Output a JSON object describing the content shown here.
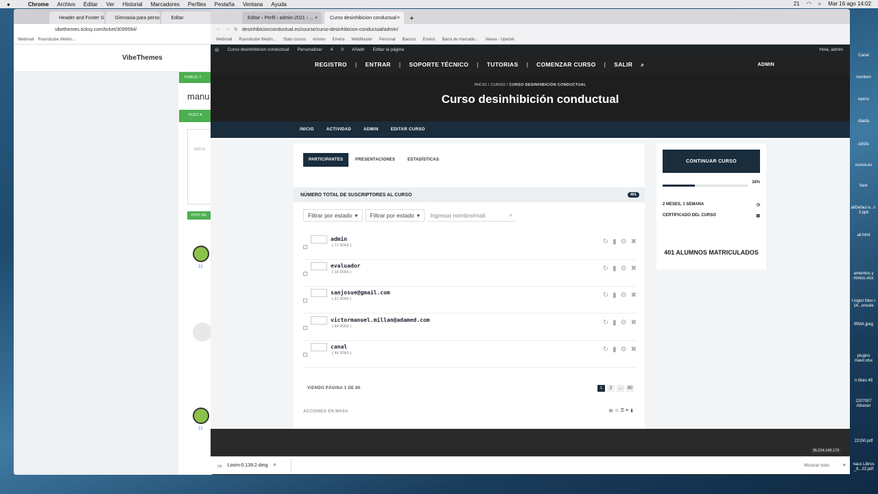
{
  "mac": {
    "menu": [
      "Chrome",
      "Archivo",
      "Editar",
      "Ver",
      "Historial",
      "Marcadores",
      "Perfiles",
      "Pestaña",
      "Ventana",
      "Ayuda"
    ],
    "battery": "21",
    "clock": "Mar 16 ago 14:02"
  },
  "desktop": {
    "items": [
      "Canal",
      "meritem",
      "eyenu",
      "dlaida",
      "ARPA",
      "nueva.es",
      "ltare",
      "ailDefaul e...t-3.ppk",
      "ail.html",
      "amientos y minios.xlsx",
      "t login/ Mon r 14...onsole",
      "IRMA.jpeg",
      "plugins mavir.xlsx",
      "n título 45",
      "2207007 Athener",
      "22150.pdf",
      "naus Libros _6...22.pdf"
    ]
  },
  "back_window": {
    "tabs": [
      "Header and Footer Scrip...",
      "Gimnasia para personas...",
      "Editar"
    ],
    "url": "vibethemes.ticksy.com/ticket/3099594/",
    "bookmarks": [
      "Webmail",
      "Roundcube Webm..."
    ],
    "site_title": "VibeThemes",
    "labels": [
      "PUBLIC T",
      "manu",
      "POST A",
      "Add to",
      "POST RE"
    ],
    "counts": [
      "21",
      "21"
    ]
  },
  "front_window": {
    "tabs": [
      "Editar ‹ Perfil ‹ admin-2021 ‹ ...",
      "Curso desinhibicion conductual"
    ],
    "url": "desinhibicionconductual.es/course/curso-desinhibicion-conductual/admin/",
    "bookmarks": [
      "Webmail",
      "Roundcube Webm...",
      "Stats cursos",
      "Amovo",
      "Emera",
      "WebMaster",
      "Personal",
      "Bancos",
      "Envios",
      "Barra de marcado...",
      "Veeva - Upwork"
    ]
  },
  "wp_admin_bar": {
    "site": "Curso desinhibicion conductual",
    "customize": "Personalizar",
    "updates": "4",
    "comments": "0",
    "new": "Añadir",
    "edit": "Editar la página",
    "notif": "1",
    "greeting": "Hola, admin"
  },
  "site_menu": {
    "items": [
      "REGISTRO",
      "ENTRAR",
      "SOPORTE TÉCNICO",
      "TUTORIAS",
      "COMENZAR CURSO",
      "SALIR"
    ],
    "admin": "ADMIN"
  },
  "breadcrumb": [
    "INICIO",
    "CURSO",
    "CURSO DESINHIBICIÓN CONDUCTUAL"
  ],
  "page_title": "Curso desinhibición conductual",
  "course_nav": [
    "INICIO",
    "ACTIVIDAD",
    "ADMIN",
    "EDITAR CURSO"
  ],
  "subtabs": [
    "PARTICIPANTES",
    "PRESENTACIONES",
    "ESTADÍSTICAS"
  ],
  "total_label": "NÚMERO TOTAL DE SUSCRIPTORES AL CURSO",
  "total_count": "401",
  "filters": {
    "status1": "Filtrar por estado",
    "status2": "Filtrar por estado",
    "search_placeholder": "Ingresar nombre/mail"
  },
  "users": [
    {
      "name": "admin",
      "days": "( 71 DÍAS )"
    },
    {
      "name": "evaluador",
      "days": "( 18 DÍAS )"
    },
    {
      "name": "sanjosue@gmail.com",
      "days": "( 21 DÍAS )"
    },
    {
      "name": "victormanuel.millan@adamed.com",
      "days": "( 44 DÍAS )"
    },
    {
      "name": "canal",
      "days": "( 44 DÍAS )"
    }
  ],
  "pagination": {
    "text": "VIENDO PÁGINA 1 DE 80",
    "pages": [
      "1",
      "2",
      "...",
      "80"
    ]
  },
  "mass_actions": "ACCIONES EN MASA",
  "sidebar": {
    "continue": "CONTINUAR CURSO",
    "progress_pct": "38%",
    "progress": 0.38,
    "duration": "2 MESES, 1 SEMANA",
    "certificate": "CERTIFICADO DEL CURSO",
    "students": "401 ALUMNOS MATRICULADOS"
  },
  "download": {
    "file": "Loom-0.139.2.dmg",
    "show_all": "Mostrar todo"
  },
  "ip": "35.214.143.173"
}
